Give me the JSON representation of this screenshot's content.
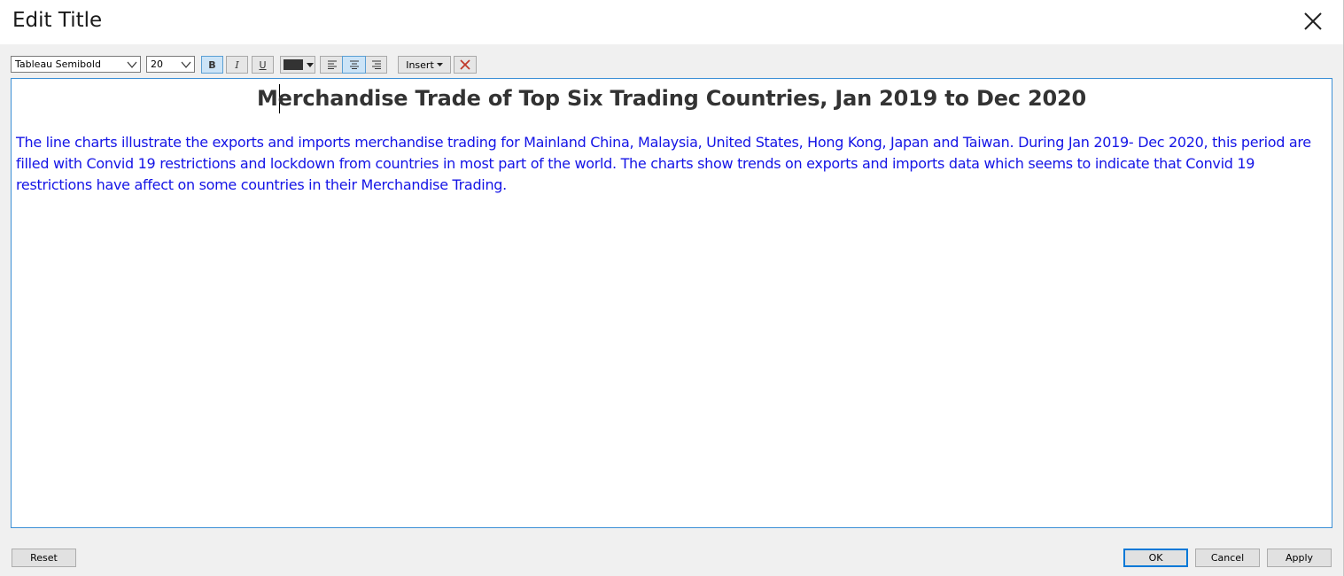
{
  "dialog": {
    "title": "Edit Title",
    "close_icon": "close-icon"
  },
  "toolbar": {
    "font_family": "Tableau Semibold",
    "font_size": "20",
    "bold_label": "B",
    "italic_label": "I",
    "underline_label": "U",
    "text_color": "#333333",
    "insert_label": "Insert",
    "bold_active": true,
    "alignment": "center"
  },
  "editor": {
    "title_text": "Merchandise Trade of Top Six Trading Countries, Jan 2019 to Dec 2020",
    "body_text": "The line charts illustrate the exports and imports merchandise trading for Mainland China, Malaysia, United States, Hong Kong, Japan and Taiwan. During Jan 2019- Dec 2020, this period are filled with Convid 19 restrictions and lockdown from countries in most part of the world. The charts show trends on exports and imports data which seems to indicate that Convid 19 restrictions have affect on some countries in their Merchandise Trading.",
    "title_color": "#333333",
    "body_color": "#1414e6"
  },
  "buttons": {
    "reset": "Reset",
    "ok": "OK",
    "cancel": "Cancel",
    "apply": "Apply"
  }
}
